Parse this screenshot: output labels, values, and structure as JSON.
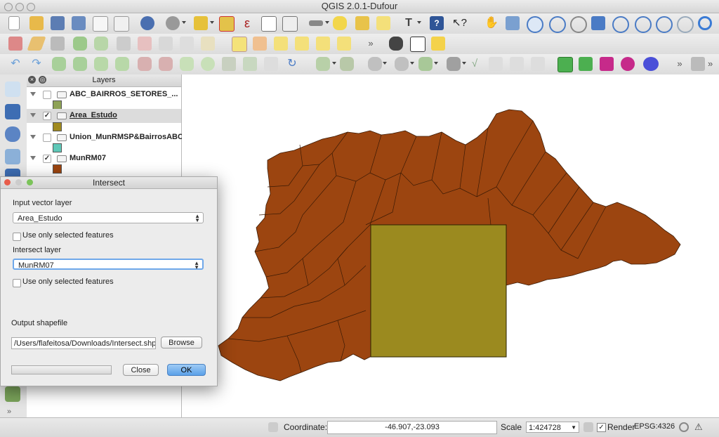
{
  "window": {
    "title": "QGIS 2.0.1-Dufour"
  },
  "layers_panel": {
    "title": "Layers",
    "layers": [
      {
        "name": "ABC_BAIRROS_SETORES_...",
        "checked": false,
        "color": "#8ea256"
      },
      {
        "name": "Area_Estudo",
        "checked": true,
        "color": "#a08a1e"
      },
      {
        "name": "Union_MunRMSP&BairrosABC",
        "checked": false,
        "color": "#5fc8b8"
      },
      {
        "name": "MunRM07",
        "checked": true,
        "color": "#9c4510"
      }
    ]
  },
  "map": {
    "region_color": "#9c4510",
    "study_area_color": "#9b8a1f"
  },
  "dialog": {
    "title": "Intersect",
    "input_label": "Input vector layer",
    "input_value": "Area_Estudo",
    "input_selected_only": "Use only selected features",
    "intersect_label": "Intersect layer",
    "intersect_value": "MunRM07",
    "intersect_selected_only": "Use only selected features",
    "output_label": "Output shapefile",
    "output_path": "/Users/flafeitosa/Downloads/Intersect.shp",
    "browse_label": "Browse",
    "close_label": "Close",
    "ok_label": "OK",
    "progress": 0
  },
  "status": {
    "coordinate_label": "Coordinate:",
    "coordinate_value": "-46.907,-23.093",
    "scale_label": "Scale",
    "scale_value": "1:424728",
    "render_label": "Render",
    "render_checked": true,
    "crs": "EPSG:4326"
  }
}
